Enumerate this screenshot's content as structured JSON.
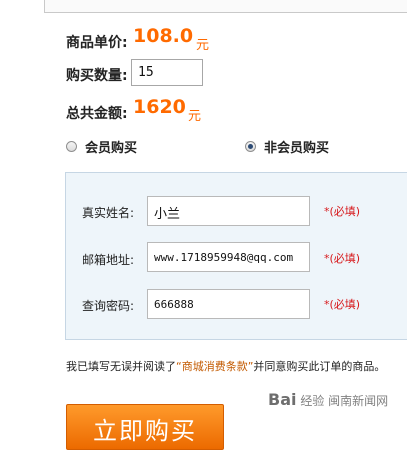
{
  "unit_price": {
    "label": "商品单价:",
    "value": "108.0",
    "unit": "元"
  },
  "quantity": {
    "label": "购买数量:",
    "value": "15"
  },
  "total": {
    "label": "总共金额:",
    "value": "1620",
    "unit": "元"
  },
  "purchase_type": {
    "member_label": "会员购买",
    "guest_label": "非会员购买",
    "selected": "guest"
  },
  "form": {
    "name": {
      "label": "真实姓名:",
      "value": "小兰",
      "required": "*(必填)"
    },
    "email": {
      "label": "邮箱地址:",
      "value": "www.1718959948@qq.com",
      "required": "*(必填)"
    },
    "password": {
      "label": "查询密码:",
      "value": "666888",
      "required": "*(必填)"
    }
  },
  "agreement": {
    "prefix": "我已填写无误并阅读了",
    "link": "“商城消费条款”",
    "suffix": "并同意购买此订单的商品。"
  },
  "buy_button": {
    "label": "立即购买"
  },
  "watermark": {
    "logo": "Bai",
    "text": "经验 闽南新闻网"
  },
  "colors": {
    "accent": "#ff6a00",
    "required": "#d7191c",
    "panel_bg": "#eef5fa"
  }
}
